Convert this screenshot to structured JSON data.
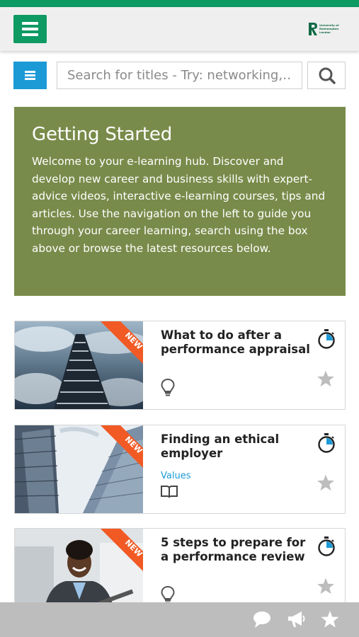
{
  "header": {
    "menu_icon": "hamburger-icon",
    "logo_text": "University of\nRoehampton\nLondon",
    "colors": {
      "brand_green": "#0e9a63",
      "accent_blue": "#1b9ad6",
      "panel_olive": "#798b4a"
    }
  },
  "search": {
    "menu_icon": "hamburger-icon",
    "placeholder": "Search for titles - Try: networking,…",
    "button_icon": "search-icon"
  },
  "getting_started": {
    "title": "Getting Started",
    "text": "Welcome to your e-learning hub. Discover and develop new career and business skills with expert-advice videos, interactive e-learning courses, tips and articles. Use the navigation on the left to guide you through your career learning, search using the box above or browse the latest resources below."
  },
  "cards": [
    {
      "title": "What to do after a performance appraisal",
      "badge": "NEW",
      "tag": "",
      "type_icon": "lightbulb-icon",
      "duration_icon": "stopwatch-icon",
      "favorite_icon": "star-icon"
    },
    {
      "title": "Finding an ethical employer",
      "badge": "NEW",
      "tag": "Values",
      "type_icon": "book-icon",
      "duration_icon": "stopwatch-icon",
      "favorite_icon": "star-icon"
    },
    {
      "title": "5 steps to prepare for a performance review",
      "badge": "NEW",
      "tag": "",
      "type_icon": "lightbulb-icon",
      "duration_icon": "stopwatch-icon",
      "favorite_icon": "star-icon"
    }
  ],
  "bottom_bar": {
    "icons": [
      "chat-icon",
      "megaphone-icon",
      "star-icon"
    ]
  }
}
